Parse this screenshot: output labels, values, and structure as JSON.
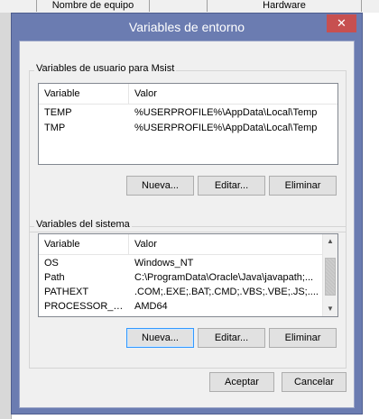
{
  "background_window": {
    "tabs": [
      "Nombre de equipo",
      "Hardware"
    ]
  },
  "dialog": {
    "title": "Variables de entorno",
    "close_glyph": "✕"
  },
  "user_section": {
    "label": "Variables de usuario para Msist",
    "columns": [
      "Variable",
      "Valor"
    ],
    "rows": [
      {
        "variable": "TEMP",
        "value": "%USERPROFILE%\\AppData\\Local\\Temp"
      },
      {
        "variable": "TMP",
        "value": "%USERPROFILE%\\AppData\\Local\\Temp"
      }
    ],
    "buttons": {
      "new": "Nueva...",
      "edit": "Editar...",
      "delete": "Eliminar"
    }
  },
  "system_section": {
    "label": "Variables del sistema",
    "columns": [
      "Variable",
      "Valor"
    ],
    "rows": [
      {
        "variable": "OS",
        "value": "Windows_NT"
      },
      {
        "variable": "Path",
        "value": "C:\\ProgramData\\Oracle\\Java\\javapath;..."
      },
      {
        "variable": "PATHEXT",
        "value": ".COM;.EXE;.BAT;.CMD;.VBS;.VBE;.JS;...."
      },
      {
        "variable": "PROCESSOR_A...",
        "value": "AMD64"
      }
    ],
    "buttons": {
      "new": "Nueva...",
      "edit": "Editar...",
      "delete": "Eliminar"
    }
  },
  "footer": {
    "ok": "Aceptar",
    "cancel": "Cancelar"
  },
  "colors": {
    "title_bar": "#6b7cb1",
    "close_button": "#c75050",
    "focus_border": "#3399ff"
  }
}
